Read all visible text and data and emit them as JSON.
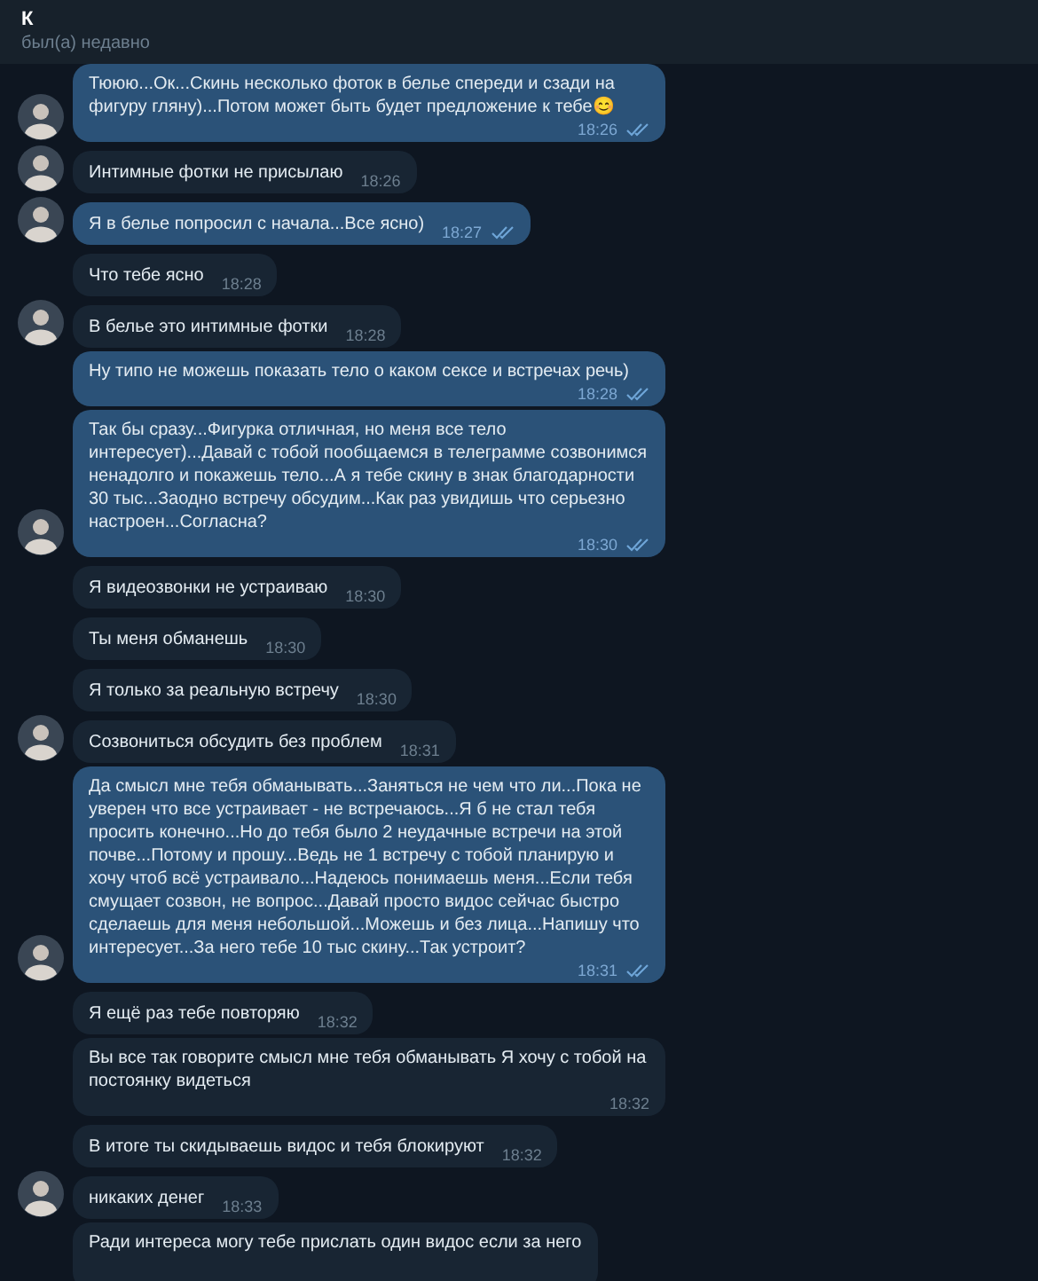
{
  "header": {
    "title": "К",
    "status": "был(а) недавно"
  },
  "messages": [
    {
      "kind": "outgoing",
      "avatar": true,
      "text": "Тююю...Ок...Скинь несколько фоток в белье спереди и сзади на фигуру гляну)...Потом может быть будет предложение к тебе😊",
      "time": "18:26",
      "read": true
    },
    {
      "kind": "incoming",
      "avatar": true,
      "text": "Интимные фотки не присылаю",
      "time": "18:26"
    },
    {
      "kind": "outgoing",
      "avatar": true,
      "text": "Я в белье попросил с начала...Все ясно)",
      "time": "18:27",
      "read": true
    },
    {
      "kind": "incoming",
      "avatar": false,
      "text": "Что тебе ясно",
      "time": "18:28"
    },
    {
      "kind": "incoming",
      "avatar": true,
      "text": "В белье это интимные фотки",
      "time": "18:28"
    },
    {
      "kind": "outgoing",
      "avatar": false,
      "text": "Ну типо не можешь показать тело о каком сексе и встречах речь)",
      "time": "18:28",
      "read": true
    },
    {
      "kind": "outgoing",
      "avatar": true,
      "text": "Так бы сразу...Фигурка отличная, но меня все тело интересует)...Давай с тобой пообщаемся в  телеграмме созвонимся ненадолго и покажешь тело...А я тебе скину в знак благодарности 30 тыс...Заодно встречу обсудим...Как раз увидишь что серьезно настроен...Согласна?",
      "time": "18:30",
      "read": true
    },
    {
      "kind": "incoming",
      "avatar": false,
      "text": "Я видеозвонки не устраиваю",
      "time": "18:30"
    },
    {
      "kind": "incoming",
      "avatar": false,
      "text": "Ты меня обманешь",
      "time": "18:30"
    },
    {
      "kind": "incoming",
      "avatar": false,
      "text": "Я только за реальную встречу",
      "time": "18:30"
    },
    {
      "kind": "incoming",
      "avatar": true,
      "text": "Созвониться обсудить без проблем",
      "time": "18:31"
    },
    {
      "kind": "outgoing",
      "avatar": true,
      "text": "Да смысл мне тебя обманывать...Заняться не чем что ли...Пока не уверен что все устраивает - не встречаюсь...Я б не стал тебя просить конечно...Но до тебя было 2 неудачные встречи на этой почве...Потому и прошу...Ведь не 1 встречу с тобой планирую и хочу чтоб всё устраивало...Надеюсь понимаешь меня...Если тебя смущает созвон, не вопрос...Давай просто видос сейчас быстро сделаешь для меня небольшой...Можешь и без лица...Напишу что интересует...За него тебе 10 тыс скину...Так устроит?",
      "time": "18:31",
      "read": true
    },
    {
      "kind": "incoming",
      "avatar": false,
      "text": "Я ещё раз тебе повторяю",
      "time": "18:32"
    },
    {
      "kind": "incoming",
      "avatar": false,
      "text": "Вы все так говорите смысл мне тебя обманывать Я хочу с тобой на постоянку видеться",
      "time": "18:32"
    },
    {
      "kind": "incoming",
      "avatar": false,
      "text": "В итоге ты скидываешь видос и тебя блокируют",
      "time": "18:32"
    },
    {
      "kind": "incoming",
      "avatar": true,
      "text": "никаких денег",
      "time": "18:33"
    },
    {
      "kind": "incoming",
      "avatar": false,
      "text": "Ради интереса могу тебе прислать один видос если за него"
    }
  ]
}
